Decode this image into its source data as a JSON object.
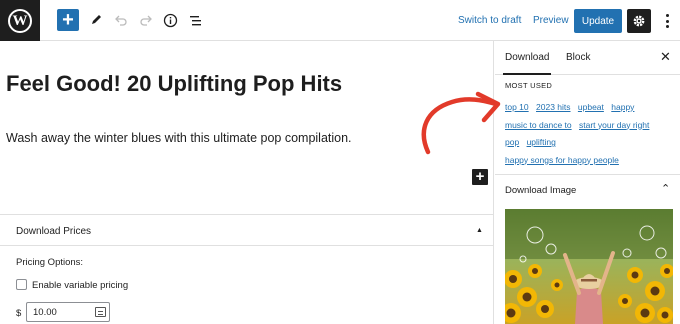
{
  "toolbar": {
    "logo_letter": "W",
    "switch_to_draft": "Switch to draft",
    "preview": "Preview",
    "update": "Update"
  },
  "editor": {
    "title": "Feel Good! 20 Uplifting Pop Hits",
    "paragraph": "Wash away the winter blues with this ultimate pop compilation."
  },
  "download_prices": {
    "title": "Download Prices",
    "pricing_options_label": "Pricing Options:",
    "variable_pricing_label": "Enable variable pricing",
    "variable_pricing_checked": false,
    "currency_symbol": "$",
    "price_value": "10.00"
  },
  "sidebar": {
    "tabs": [
      {
        "label": "Download",
        "active": true
      },
      {
        "label": "Block",
        "active": false
      }
    ],
    "most_used_label": "MOST USED",
    "tags": [
      "top 10",
      "2023 hits",
      "upbeat",
      "happy",
      "music to dance to",
      "start your day right",
      "pop",
      "uplifting",
      "happy songs for happy people"
    ],
    "download_image_title": "Download Image"
  },
  "colors": {
    "accent": "#2271b1",
    "dark": "#1e1e1e",
    "annotation_arrow": "#e23a2a"
  },
  "icons": [
    "wordpress-logo-icon",
    "plus-icon",
    "pencil-icon",
    "undo-icon",
    "redo-icon",
    "info-icon",
    "list-view-icon",
    "gear-icon",
    "more-vertical-icon",
    "close-icon",
    "chevron-up-icon",
    "calculator-icon"
  ]
}
